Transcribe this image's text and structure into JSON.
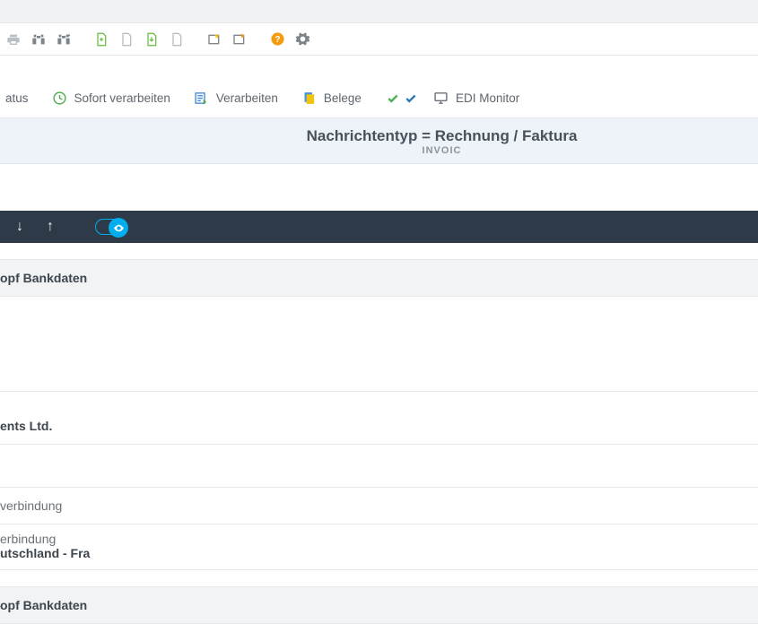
{
  "actions": {
    "item0": "atus",
    "item1": "Sofort verarbeiten",
    "item2": "Verarbeiten",
    "item3": "Belege",
    "item4": "EDI Monitor"
  },
  "header": {
    "title": "Nachrichtentyp = Rechnung / Faktura",
    "subtitle": "INVOIC"
  },
  "sections": {
    "s0": "opf Bankdaten",
    "s1": "ents Ltd.",
    "s2": "verbindung",
    "s3_line1": "erbindung",
    "s3_line2": "utschland - Fra",
    "s4": "opf Bankdaten"
  }
}
